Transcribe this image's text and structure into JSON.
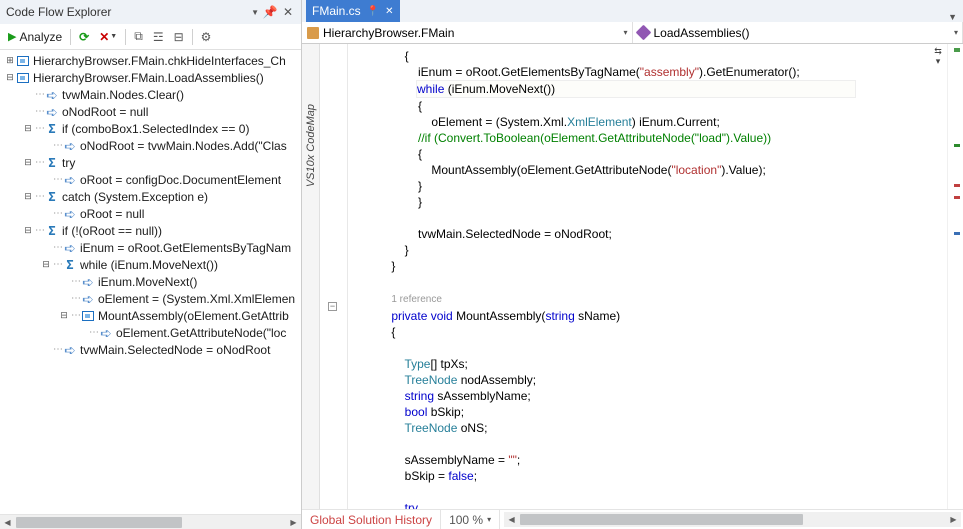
{
  "explorer": {
    "title": "Code Flow Explorer",
    "analyze_label": "Analyze",
    "tree": [
      {
        "depth": 0,
        "exp": "+",
        "icon": "box",
        "text": "HierarchyBrowser.FMain.chkHideInterfaces_Ch"
      },
      {
        "depth": 0,
        "exp": "-",
        "icon": "box",
        "text": "HierarchyBrowser.FMain.LoadAssemblies()"
      },
      {
        "depth": 1,
        "exp": "",
        "icon": "arrow",
        "text": "tvwMain.Nodes.Clear()"
      },
      {
        "depth": 1,
        "exp": "",
        "icon": "arrow",
        "text": "oNodRoot = null"
      },
      {
        "depth": 1,
        "exp": "-",
        "icon": "sig",
        "text": "if (comboBox1.SelectedIndex == 0)"
      },
      {
        "depth": 2,
        "exp": "",
        "icon": "arrow",
        "text": "oNodRoot = tvwMain.Nodes.Add(\"Clas"
      },
      {
        "depth": 1,
        "exp": "-",
        "icon": "sig",
        "text": "try"
      },
      {
        "depth": 2,
        "exp": "",
        "icon": "arrow",
        "text": "oRoot = configDoc.DocumentElement"
      },
      {
        "depth": 1,
        "exp": "-",
        "icon": "sig",
        "text": "catch (System.Exception e)"
      },
      {
        "depth": 2,
        "exp": "",
        "icon": "arrow",
        "text": "oRoot = null"
      },
      {
        "depth": 1,
        "exp": "-",
        "icon": "sig",
        "text": "if (!(oRoot == null))"
      },
      {
        "depth": 2,
        "exp": "",
        "icon": "arrow",
        "text": "iEnum = oRoot.GetElementsByTagNam"
      },
      {
        "depth": 2,
        "exp": "-",
        "icon": "sig",
        "text": "while (iEnum.MoveNext())"
      },
      {
        "depth": 3,
        "exp": "",
        "icon": "arrow",
        "text": "iEnum.MoveNext()"
      },
      {
        "depth": 3,
        "exp": "",
        "icon": "arrow",
        "text": "oElement = (System.Xml.XmlElemen"
      },
      {
        "depth": 3,
        "exp": "-",
        "icon": "box",
        "text": "MountAssembly(oElement.GetAttrib"
      },
      {
        "depth": 4,
        "exp": "",
        "icon": "arrow",
        "text": "oElement.GetAttributeNode(\"loc"
      },
      {
        "depth": 2,
        "exp": "",
        "icon": "arrow",
        "text": "tvwMain.SelectedNode = oNodRoot"
      }
    ]
  },
  "editor": {
    "tab_label": "FMain.cs",
    "class_combo": "HierarchyBrowser.FMain",
    "method_combo": "LoadAssemblies()",
    "codemap_label": "VS10x CodeMap",
    "ref_annotation": "1 reference",
    "code_lines": [
      "        {",
      "            iEnum = oRoot.GetElementsByTagName(\"assembly\").GetEnumerator();",
      "HL            while (iEnum.MoveNext())",
      "            {",
      "                oElement = (System.Xml.XmlElement) iEnum.Current;",
      "            //if (Convert.ToBoolean(oElement.GetAttributeNode(\"load\").Value))",
      "            {",
      "                MountAssembly(oElement.GetAttributeNode(\"location\").Value);",
      "            }",
      "            }",
      "",
      "            tvwMain.SelectedNode = oNodRoot;",
      "        }",
      "    }",
      "",
      "REF",
      "    private void MountAssembly(string sName)",
      "    {",
      "",
      "        Type[] tpXs;",
      "        TreeNode nodAssembly;",
      "        string sAssemblyName;",
      "        bool bSkip;",
      "        TreeNode oNS;",
      "",
      "        sAssemblyName = \"\";",
      "        bSkip = false;",
      "",
      "        try"
    ]
  },
  "status": {
    "history_label": "Global Solution History",
    "zoom": "100 %"
  }
}
